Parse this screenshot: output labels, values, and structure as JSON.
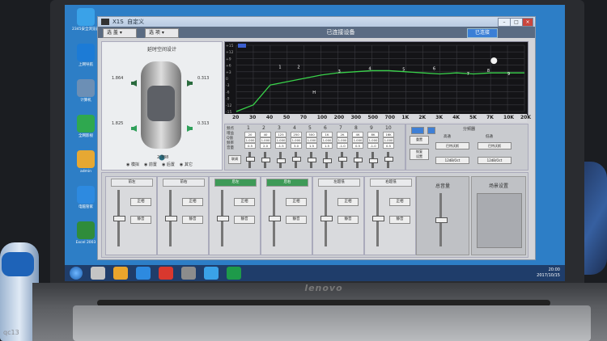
{
  "desktop": {
    "icons": [
      {
        "label": "2345安全浏览器",
        "color": "#3aa2e8"
      },
      {
        "label": "上网导航",
        "color": "#1c7bd6"
      },
      {
        "label": "计算机",
        "color": "#6c8fb5"
      },
      {
        "label": "全网影视",
        "color": "#2fa84f"
      },
      {
        "label": "admin",
        "color": "#e6a833"
      },
      {
        "label": "电脑管家",
        "color": "#2d8ae0"
      },
      {
        "label": "Excel 2003",
        "color": "#2f8c3b"
      }
    ]
  },
  "taskbar": {
    "time": "20:00",
    "date": "2017/10/15"
  },
  "window": {
    "app_name": "X1S",
    "title": "自定义",
    "menu": [
      "选 盖",
      "选 项"
    ],
    "status": "已连接设备",
    "connect_label": "已连接"
  },
  "car_panel": {
    "title": "延时空间设计",
    "values": {
      "fl": "1.864",
      "fr": "0.313",
      "rl": "1.825",
      "rr": "0.313",
      "sub": "2.788"
    },
    "radio": [
      "模拟",
      "前置",
      "后置",
      "其它"
    ]
  },
  "graph": {
    "y_ticks": [
      "+15",
      "+12",
      "+9",
      "+6",
      "+3",
      "0",
      "-3",
      "-6",
      "-9",
      "-12",
      "-15"
    ],
    "freq_ticks": [
      "20",
      "30",
      "40",
      "50",
      "70",
      "100",
      "200",
      "300",
      "500",
      "700",
      "1K",
      "2K",
      "3K",
      "4K",
      "5K",
      "7K",
      "10K",
      "20K"
    ],
    "point_labels": [
      "1",
      "2",
      "3",
      "4",
      "5",
      "6",
      "7",
      "8",
      "9",
      "10",
      "H"
    ]
  },
  "eq": {
    "row_labels": [
      "频点",
      "增益",
      "Q值",
      "频率",
      "音量"
    ],
    "bands": [
      {
        "n": "1",
        "cells": [
          "20",
          "1.000",
          "0.5"
        ]
      },
      {
        "n": "2",
        "cells": [
          "40",
          "1.000",
          "2.0"
        ]
      },
      {
        "n": "3",
        "cells": [
          "125",
          "1.000",
          "-1.5"
        ]
      },
      {
        "n": "4",
        "cells": [
          "250",
          "1.000",
          "3.0"
        ]
      },
      {
        "n": "5",
        "cells": [
          "500",
          "1.000",
          "1.5"
        ]
      },
      {
        "n": "6",
        "cells": [
          "1K",
          "1.000",
          "1.5"
        ]
      },
      {
        "n": "7",
        "cells": [
          "2K",
          "1.000",
          "-1.0"
        ]
      },
      {
        "n": "8",
        "cells": [
          "4K",
          "1.000",
          "0.5"
        ]
      },
      {
        "n": "9",
        "cells": [
          "8K",
          "1.000",
          "-1.0"
        ]
      },
      {
        "n": "10",
        "cells": [
          "16K",
          "1.000",
          "0.5"
        ]
      }
    ],
    "reset_label": "重置",
    "link_label": "联调",
    "restore_label": "恢复\n设置"
  },
  "crossover": {
    "title": "分频器",
    "hp_label": "高通",
    "lp_label": "低通",
    "items": [
      "巴特沃斯",
      "巴特沃斯",
      "12dB/Oct",
      "12dB/Oct"
    ]
  },
  "channels": [
    {
      "name": "前左",
      "selected": false,
      "mute": "静音",
      "phase": "正相",
      "level": 0.55
    },
    {
      "name": "前右",
      "selected": false,
      "mute": "静音",
      "phase": "正相",
      "level": 0.55
    },
    {
      "name": "后左",
      "selected": true,
      "mute": "静音",
      "phase": "正相",
      "level": 0.55
    },
    {
      "name": "后右",
      "selected": true,
      "mute": "静音",
      "phase": "正相",
      "level": 0.55
    },
    {
      "name": "左超低",
      "selected": false,
      "mute": "静音",
      "phase": "正相",
      "level": 0.55
    },
    {
      "name": "右超低",
      "selected": false,
      "mute": "静音",
      "phase": "正相",
      "level": 0.55
    }
  ],
  "master": {
    "title": "总音量",
    "preset_title": "场景设置"
  },
  "brand": "lenovo",
  "watermark": "qc13"
}
